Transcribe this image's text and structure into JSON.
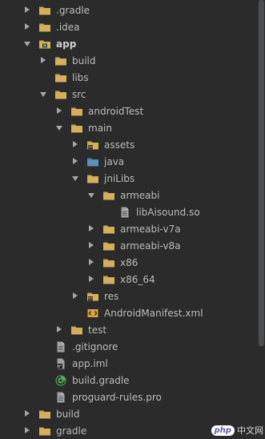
{
  "tree": {
    "nodes": [
      {
        "label": ".gradle",
        "depth": 0,
        "arrow": "closed",
        "icon": "folder-icon"
      },
      {
        "label": ".idea",
        "depth": 0,
        "arrow": "closed",
        "icon": "folder-icon"
      },
      {
        "label": "app",
        "depth": 0,
        "arrow": "open",
        "icon": "module-folder-icon",
        "bold": true
      },
      {
        "label": "build",
        "depth": 1,
        "arrow": "closed",
        "icon": "folder-icon"
      },
      {
        "label": "libs",
        "depth": 1,
        "arrow": "none",
        "icon": "folder-icon"
      },
      {
        "label": "src",
        "depth": 1,
        "arrow": "open",
        "icon": "folder-icon"
      },
      {
        "label": "androidTest",
        "depth": 2,
        "arrow": "closed",
        "icon": "folder-icon"
      },
      {
        "label": "main",
        "depth": 2,
        "arrow": "open",
        "icon": "folder-icon"
      },
      {
        "label": "assets",
        "depth": 3,
        "arrow": "closed",
        "icon": "resource-folder-icon"
      },
      {
        "label": "java",
        "depth": 3,
        "arrow": "closed",
        "icon": "source-folder-icon"
      },
      {
        "label": "jniLibs",
        "depth": 3,
        "arrow": "open",
        "icon": "folder-icon"
      },
      {
        "label": "armeabi",
        "depth": 4,
        "arrow": "open",
        "icon": "folder-icon"
      },
      {
        "label": "libAisound.so",
        "depth": 5,
        "arrow": "none",
        "icon": "file-icon"
      },
      {
        "label": "armeabi-v7a",
        "depth": 4,
        "arrow": "closed",
        "icon": "folder-icon"
      },
      {
        "label": "armeabi-v8a",
        "depth": 4,
        "arrow": "closed",
        "icon": "folder-icon"
      },
      {
        "label": "x86",
        "depth": 4,
        "arrow": "closed",
        "icon": "folder-icon"
      },
      {
        "label": "x86_64",
        "depth": 4,
        "arrow": "closed",
        "icon": "folder-icon"
      },
      {
        "label": "res",
        "depth": 3,
        "arrow": "closed",
        "icon": "resource-folder-icon"
      },
      {
        "label": "AndroidManifest.xml",
        "depth": 3,
        "arrow": "none",
        "icon": "manifest-icon"
      },
      {
        "label": "test",
        "depth": 2,
        "arrow": "closed",
        "icon": "folder-icon"
      },
      {
        "label": ".gitignore",
        "depth": 1,
        "arrow": "none",
        "icon": "file-icon"
      },
      {
        "label": "app.iml",
        "depth": 1,
        "arrow": "none",
        "icon": "iml-file-icon"
      },
      {
        "label": "build.gradle",
        "depth": 1,
        "arrow": "none",
        "icon": "gradle-icon"
      },
      {
        "label": "proguard-rules.pro",
        "depth": 1,
        "arrow": "none",
        "icon": "file-icon"
      },
      {
        "label": "build",
        "depth": 0,
        "arrow": "closed",
        "icon": "folder-icon"
      },
      {
        "label": "gradle",
        "depth": 0,
        "arrow": "closed",
        "icon": "folder-icon"
      }
    ]
  },
  "watermark": {
    "badge": "php",
    "text": "中文网"
  },
  "colors": {
    "background": "#2b2b2b",
    "text": "#bbbbbb",
    "folder": "#c7a353",
    "source_folder": "#5d8fbd",
    "resource_badge": "#d9a441",
    "gradle_green": "#4caf50"
  }
}
